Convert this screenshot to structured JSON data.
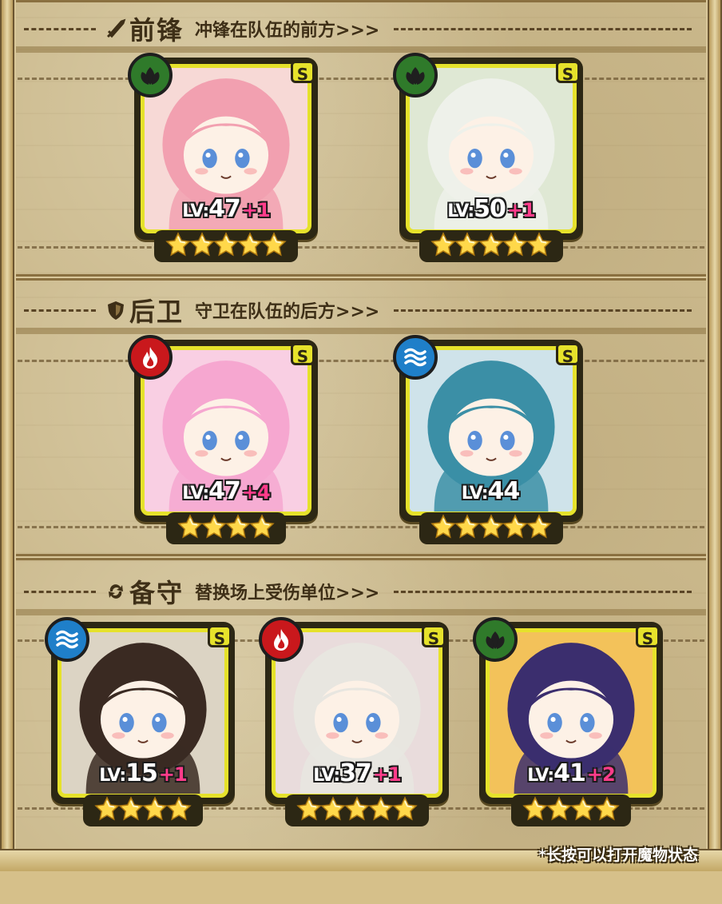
{
  "sections": {
    "front": {
      "title": "前锋",
      "subtitle": "冲锋在队伍的前方>>>"
    },
    "back": {
      "title": "后卫",
      "subtitle": "守卫在队伍的后方>>>"
    },
    "reserve": {
      "title": "备守",
      "subtitle": "替换场上受伤单位>>>"
    }
  },
  "cards": [
    {
      "rank": "S",
      "element": "leaf",
      "lv_prefix": "LV:",
      "level": "47",
      "plus": "+1",
      "stars": 5,
      "hair": "#f2a0b0",
      "bg": "#f7d9d6"
    },
    {
      "rank": "S",
      "element": "leaf",
      "lv_prefix": "LV:",
      "level": "50",
      "plus": "+1",
      "stars": 5,
      "hair": "#eef1ea",
      "bg": "#dfe8d4"
    },
    {
      "rank": "S",
      "element": "fire",
      "lv_prefix": "LV:",
      "level": "47",
      "plus": "+4",
      "stars": 4,
      "hair": "#f6a7d0",
      "bg": "#f9cfe3"
    },
    {
      "rank": "S",
      "element": "water",
      "lv_prefix": "LV:",
      "level": "44",
      "plus": "",
      "stars": 5,
      "hair": "#3b8fa6",
      "bg": "#cfe3ea"
    },
    {
      "rank": "S",
      "element": "water",
      "lv_prefix": "LV:",
      "level": "15",
      "plus": "+1",
      "stars": 4,
      "hair": "#3a2a22",
      "bg": "#dcd4c4"
    },
    {
      "rank": "S",
      "element": "fire",
      "lv_prefix": "LV:",
      "level": "37",
      "plus": "+1",
      "stars": 5,
      "hair": "#e8e6e0",
      "bg": "#e9dcdc"
    },
    {
      "rank": "S",
      "element": "leaf",
      "lv_prefix": "LV:",
      "level": "41",
      "plus": "+2",
      "stars": 4,
      "hair": "#3b2e6e",
      "bg": "#f3c25a"
    }
  ],
  "footnote": "*长按可以打开魔物状态",
  "colors": {
    "frame": "#e6e22b",
    "plus": "#ff3c8a",
    "leaf": "#2f7a2a",
    "fire": "#c9181c",
    "water": "#1f7fc9"
  }
}
